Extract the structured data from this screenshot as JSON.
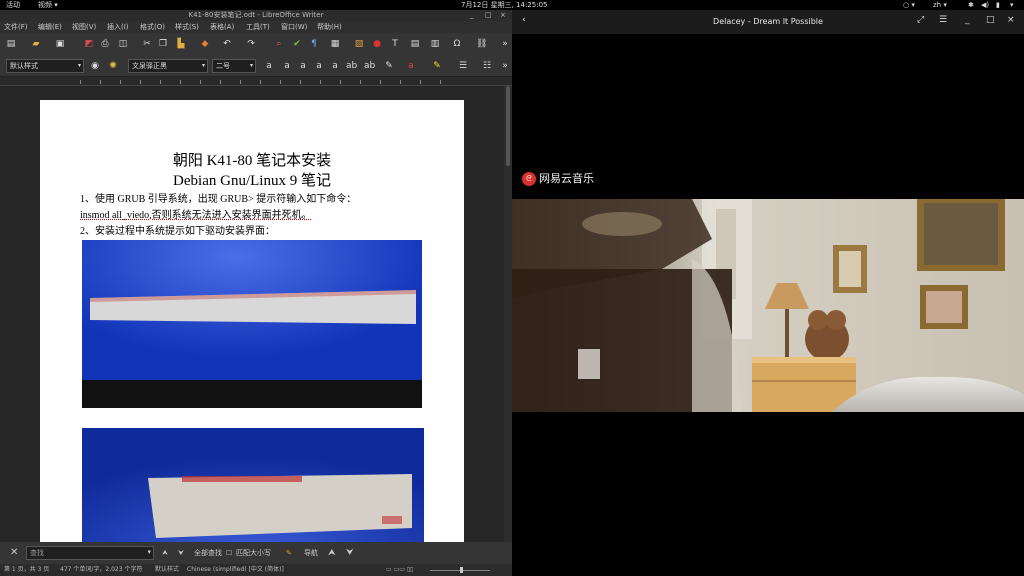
{
  "topbar": {
    "activities": "活动",
    "app_menu": "视频 ▾",
    "clock": "7月12日 星期三, 14:25:05",
    "lang": "zh ▾",
    "indicator_icons": [
      "bluetooth-icon",
      "volume-icon",
      "network-icon",
      "power-icon"
    ]
  },
  "writer": {
    "title": "K41-80安装笔记.odt - LibreOffice Writer",
    "menu": [
      "文件(F)",
      "编辑(E)",
      "视图(V)",
      "插入(I)",
      "格式(O)",
      "样式(S)",
      "表格(A)",
      "工具(T)",
      "窗口(W)",
      "帮助(H)"
    ],
    "para_style": "默认样式",
    "font_name": "文泉驿正黑",
    "font_size": "二号",
    "doc": {
      "title_line1": "朝阳 K41-80 笔记本安装",
      "title_line2": "Debian Gnu/Linux 9 笔记",
      "line1": "1、使用 GRUB 引导系统，出现 GRUB> 提示符输入如下命令：",
      "line2": "insmod all_viedo,否则系统无法进入安装界面并死机。",
      "line3": "2、安装过程中系统提示如下驱动安装界面："
    },
    "findbar": {
      "placeholder": "查找",
      "find_all": "全部查找",
      "match_case": "匹配大小写",
      "format": "导航"
    },
    "status": {
      "page": "第 1 页，共 3 页",
      "words": "477 个单词/字，2,023 个字符",
      "style": "默认样式",
      "lang": "Chinese (simplified) [中文 (简体)]"
    }
  },
  "player": {
    "title": "Delacey - Dream It Possible",
    "brand": "网易云音乐"
  },
  "colors": {
    "installer_blue": "#1234b8",
    "brand_red": "#d9322e"
  }
}
